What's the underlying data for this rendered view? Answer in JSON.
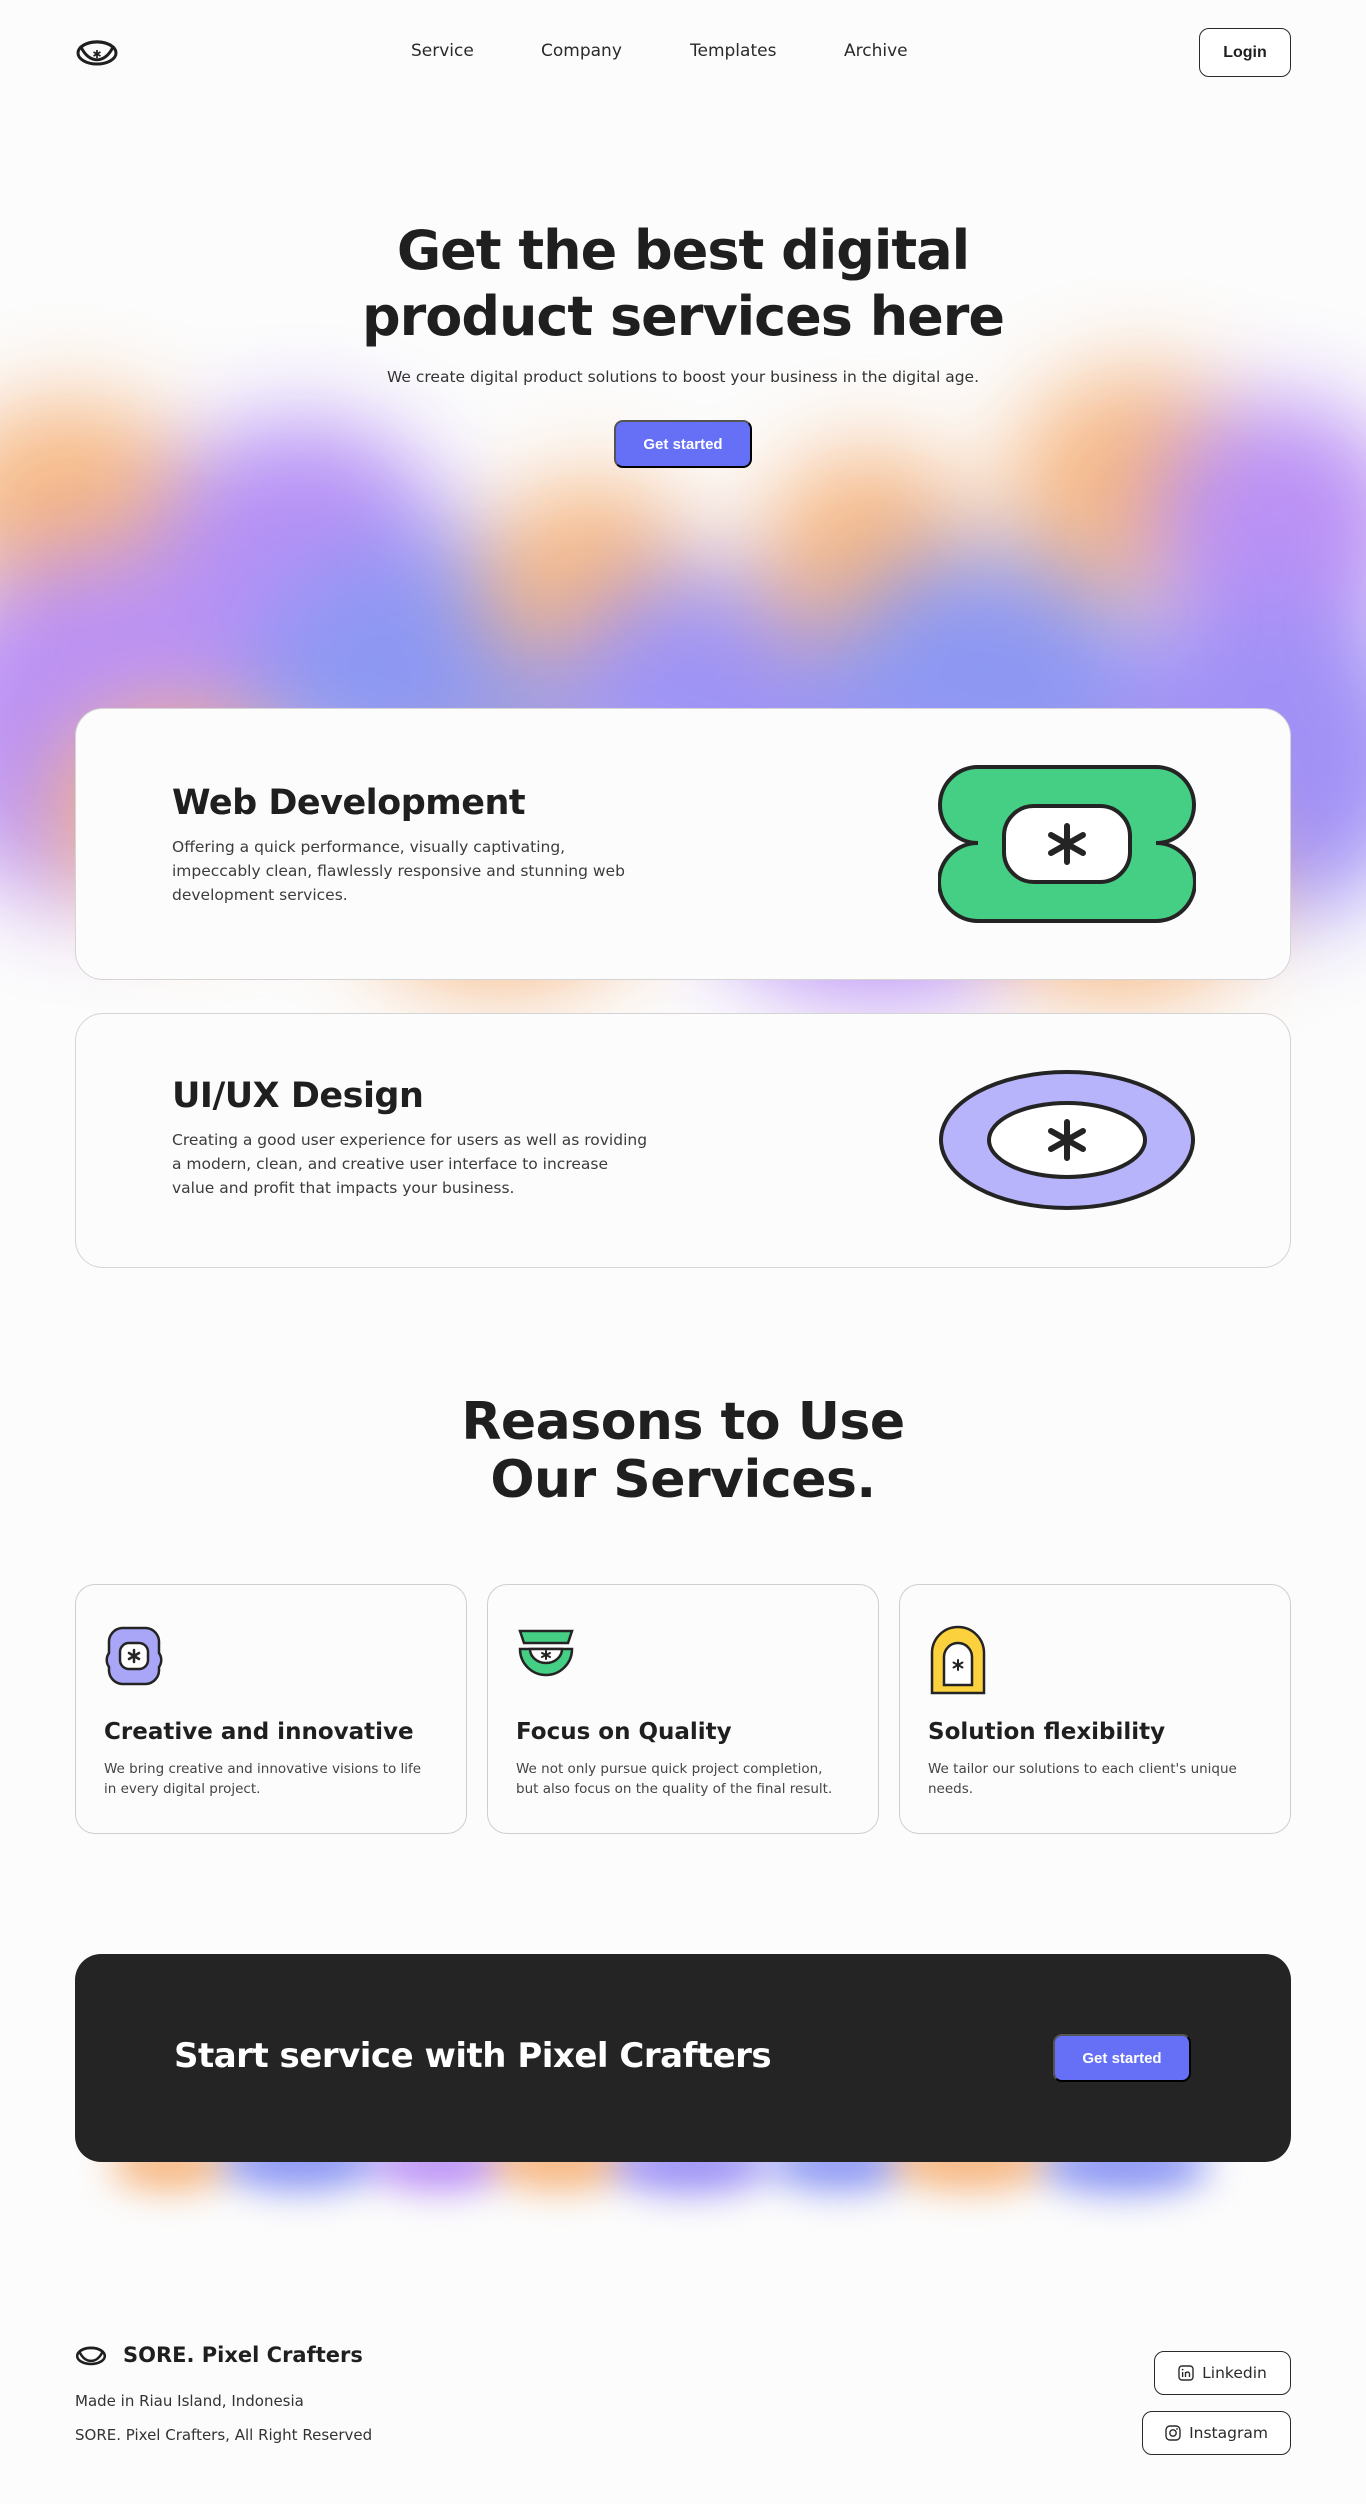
{
  "nav": {
    "links": [
      "Service",
      "Company",
      "Templates",
      "Archive"
    ],
    "login_label": "Login"
  },
  "hero": {
    "title_line1": "Get the best digital",
    "title_line2": "product services here",
    "subtitle": "We create digital product solutions to boost your business in the digital age.",
    "cta_label": "Get started"
  },
  "services": [
    {
      "title": "Web Development",
      "description": "Offering a quick performance, visually captivating, impeccably clean, flawlessly responsive and stunning web development services.",
      "icon": "green-badge-icon",
      "color": "#45cf85"
    },
    {
      "title": "UI/UX Design",
      "description": "Creating a good user experience for users as well as roviding a modern, clean, and creative user interface to increase value and profit that impacts your business.",
      "icon": "lavender-oval-icon",
      "color": "#b8b4fb"
    }
  ],
  "reasons": {
    "title_line1": "Reasons to Use",
    "title_line2": "Our Services.",
    "items": [
      {
        "title": "Creative and innovative",
        "description": "We bring creative and innovative visions to life in every digital project.",
        "icon": "lavender-flower-icon",
        "color": "#a9a6f7"
      },
      {
        "title": "Focus on Quality",
        "description": "We not only pursue quick project completion, but also focus on the quality of the final result.",
        "icon": "green-bowl-icon",
        "color": "#45cf85"
      },
      {
        "title": "Solution flexibility",
        "description": "We tailor our solutions to each client's unique needs.",
        "icon": "yellow-arch-icon",
        "color": "#fbd23e"
      }
    ]
  },
  "cta": {
    "title": "Start service with Pixel Crafters",
    "button_label": "Get started"
  },
  "footer": {
    "brand": "SORE. Pixel Crafters",
    "location": "Made in Riau Island, Indonesia",
    "copyright": "SORE. Pixel Crafters, All Right Reserved",
    "social": [
      {
        "label": "Linkedin",
        "icon": "linkedin-icon"
      },
      {
        "label": "Instagram",
        "icon": "instagram-icon"
      }
    ]
  },
  "colors": {
    "accent": "#6570f7",
    "dark": "#242424",
    "blur_orange": "#f6b57f",
    "blur_purple": "#b88cf5",
    "blur_blue": "#8893f3"
  }
}
